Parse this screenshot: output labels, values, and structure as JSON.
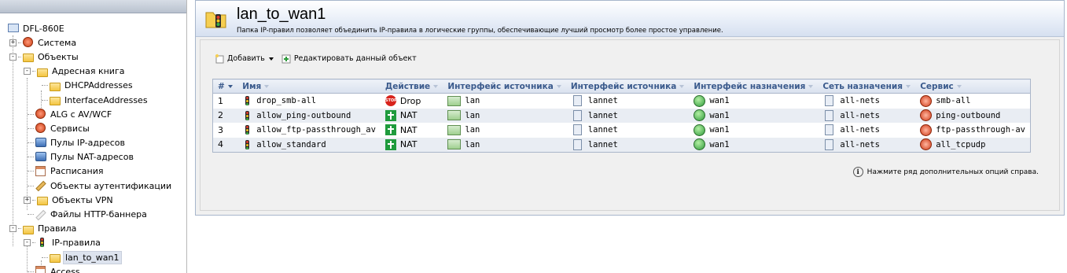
{
  "tree": {
    "items": [
      {
        "label": "DFL-860E",
        "icon": "device-icon",
        "toggle": ""
      },
      {
        "label": "Система",
        "icon": "system-icon",
        "toggle": "+"
      },
      {
        "label": "Объекты",
        "icon": "folder-icon",
        "toggle": "-"
      },
      {
        "label": "Адресная книга",
        "icon": "address-book-icon",
        "toggle": "-"
      },
      {
        "label": "DHCPAddresses",
        "icon": "folder-icon",
        "toggle": ""
      },
      {
        "label": "InterfaceAddresses",
        "icon": "folder-icon",
        "toggle": ""
      },
      {
        "label": "ALG с AV/WCF",
        "icon": "alg-icon",
        "toggle": ""
      },
      {
        "label": "Сервисы",
        "icon": "services-icon",
        "toggle": ""
      },
      {
        "label": "Пулы IP-адресов",
        "icon": "ip-pool-icon",
        "toggle": ""
      },
      {
        "label": "Пулы NAT-адресов",
        "icon": "nat-pool-icon",
        "toggle": ""
      },
      {
        "label": "Расписания",
        "icon": "schedule-icon",
        "toggle": ""
      },
      {
        "label": "Объекты аутентификации",
        "icon": "auth-icon",
        "toggle": ""
      },
      {
        "label": "Объекты VPN",
        "icon": "folder-icon",
        "toggle": "+"
      },
      {
        "label": "Файлы HTTP-баннера",
        "icon": "banner-file-icon",
        "toggle": ""
      },
      {
        "label": "Правила",
        "icon": "rules-icon",
        "toggle": "-"
      },
      {
        "label": "IP-правила",
        "icon": "ip-rules-icon",
        "toggle": "-"
      },
      {
        "label": "lan_to_wan1",
        "icon": "rule-folder-icon",
        "toggle": ""
      },
      {
        "label": "Access",
        "icon": "access-icon",
        "toggle": ""
      }
    ]
  },
  "header": {
    "title": "lan_to_wan1",
    "description": "Папка IP-правил позволяет объединить IP-правила в логические группы, обеспечивающие лучший просмотр более простое управление."
  },
  "toolbar": {
    "add_label": "Добавить",
    "edit_label": "Редактировать данный объект"
  },
  "table": {
    "headers": [
      "#",
      "Имя",
      "Действие",
      "Интерфейс источника",
      "Интерфейс источника",
      "Интерфейс назначения",
      "Сеть назначения",
      "Сервис"
    ],
    "rows": [
      {
        "num": "1",
        "name": "drop_smb-all",
        "action": "Drop",
        "action_icon": "stop-icon",
        "src_iface": "lan",
        "src_net": "lannet",
        "dst_iface": "wan1",
        "dst_net": "all-nets",
        "service": "smb-all"
      },
      {
        "num": "2",
        "name": "allow_ping-outbound",
        "action": "NAT",
        "action_icon": "nat-icon",
        "src_iface": "lan",
        "src_net": "lannet",
        "dst_iface": "wan1",
        "dst_net": "all-nets",
        "service": "ping-outbound"
      },
      {
        "num": "3",
        "name": "allow_ftp-passthrough_av",
        "action": "NAT",
        "action_icon": "nat-icon",
        "src_iface": "lan",
        "src_net": "lannet",
        "dst_iface": "wan1",
        "dst_net": "all-nets",
        "service": "ftp-passthrough-av"
      },
      {
        "num": "4",
        "name": "allow_standard",
        "action": "NAT",
        "action_icon": "nat-icon",
        "src_iface": "lan",
        "src_net": "lannet",
        "dst_iface": "wan1",
        "dst_net": "all-nets",
        "service": "all_tcpudp"
      }
    ]
  },
  "hint": {
    "text": "Нажмите ряд дополнительных опций справа."
  }
}
